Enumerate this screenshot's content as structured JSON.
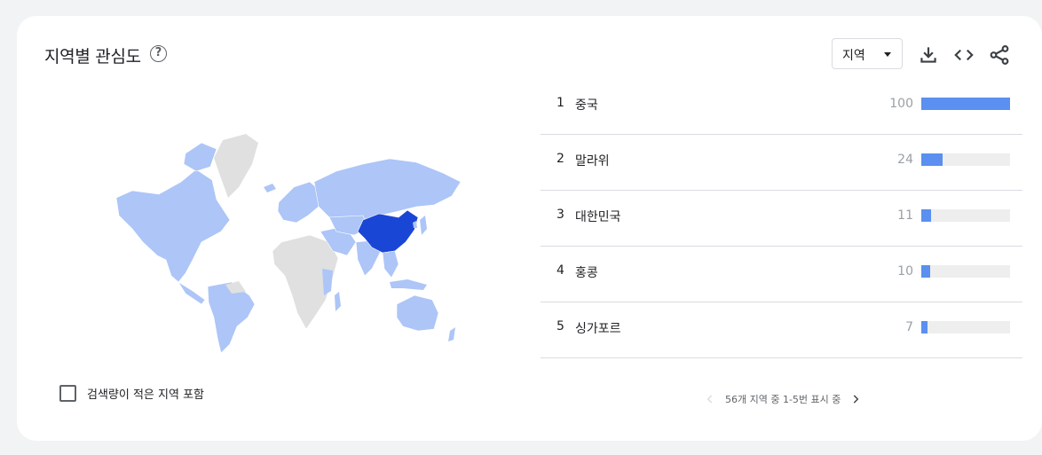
{
  "header": {
    "title": "지역별 관심도",
    "help_glyph": "?",
    "region_select_value": "지역"
  },
  "toolbar_icons": [
    "download-icon",
    "embed-code-icon",
    "share-icon"
  ],
  "map": {
    "highlight_color": "#1a46d6",
    "mid_color": "#adc5f7",
    "no_data_color": "#e0e0e0",
    "top_region": "중국"
  },
  "checkbox": {
    "label": "검색량이 적은 지역 포함",
    "checked": false
  },
  "rankings": [
    {
      "rank": "1",
      "name": "중국",
      "value": "100",
      "level": 1.0
    },
    {
      "rank": "2",
      "name": "말라위",
      "value": "24",
      "level": 0.24
    },
    {
      "rank": "3",
      "name": "대한민국",
      "value": "11",
      "level": 0.11
    },
    {
      "rank": "4",
      "name": "홍콩",
      "value": "10",
      "level": 0.1
    },
    {
      "rank": "5",
      "name": "싱가포르",
      "value": "7",
      "level": 0.07
    }
  ],
  "pagination": {
    "text": "56개 지역 중 1-5번 표시 중"
  }
}
